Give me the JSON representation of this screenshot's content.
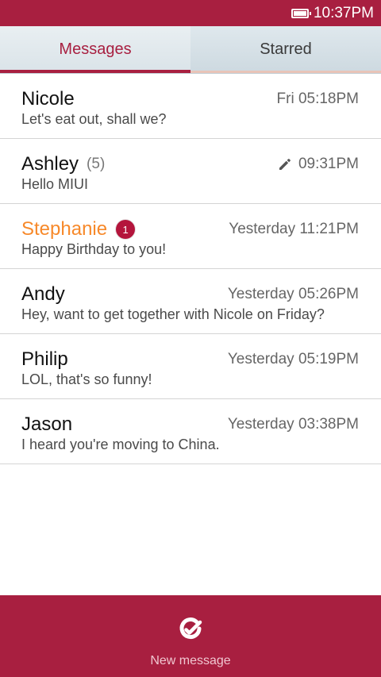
{
  "status_bar": {
    "time": "10:37PM",
    "battery_icon": "battery-icon"
  },
  "tabs": [
    {
      "label": "Messages",
      "selected": true
    },
    {
      "label": "Starred",
      "selected": false
    }
  ],
  "messages": [
    {
      "name": "Nicole",
      "count": "",
      "badge": "",
      "draft": false,
      "time": "Fri 05:18PM",
      "preview": "Let's eat out, shall we?",
      "unread": false
    },
    {
      "name": "Ashley",
      "count": "(5)",
      "badge": "",
      "draft": true,
      "time": "09:31PM",
      "preview": "Hello MIUI",
      "unread": false
    },
    {
      "name": "Stephanie",
      "count": "",
      "badge": "1",
      "draft": false,
      "time": "Yesterday 11:21PM",
      "preview": "Happy Birthday to you!",
      "unread": true
    },
    {
      "name": "Andy",
      "count": "",
      "badge": "",
      "draft": false,
      "time": "Yesterday 05:26PM",
      "preview": "Hey, want to get together with Nicole on Friday?",
      "unread": false
    },
    {
      "name": "Philip",
      "count": "",
      "badge": "",
      "draft": false,
      "time": "Yesterday 05:19PM",
      "preview": "LOL, that's so funny!",
      "unread": false
    },
    {
      "name": "Jason",
      "count": "",
      "badge": "",
      "draft": false,
      "time": "Yesterday 03:38PM",
      "preview": "I heard you're moving to China.",
      "unread": false
    }
  ],
  "bottom_bar": {
    "compose_icon": "compose-icon",
    "label": "New message"
  },
  "colors": {
    "accent": "#a81f40",
    "unread_name": "#f7892a",
    "badge": "#b4153c"
  }
}
